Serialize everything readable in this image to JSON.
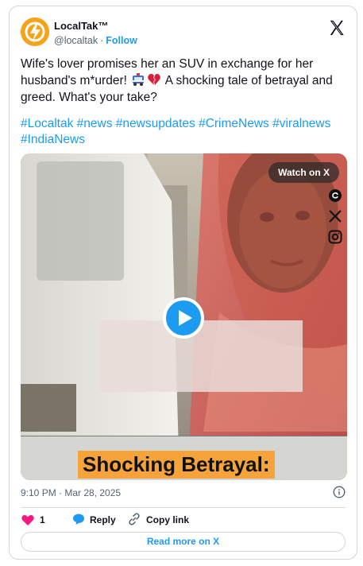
{
  "author": {
    "display_name": "LocalTak™",
    "handle": "@localtak",
    "separator": "·",
    "follow_label": "Follow",
    "avatar_color": "#f6a31a"
  },
  "tweet": {
    "text_before_emoji": "Wife's lover promises her an SUV in exchange for her husband's m*urder! ",
    "emojis": [
      "police-car-icon",
      "broken-heart-icon"
    ],
    "text_after_emoji": " A shocking tale of betrayal and greed. What's your take?",
    "hashtags": [
      "#Localtak",
      "#news",
      "#newsupdates",
      "#CrimeNews",
      "#viralnews",
      "#IndiaNews"
    ]
  },
  "media": {
    "watch_label": "Watch on X",
    "side_icons": [
      "threads-icon",
      "x-logo-icon",
      "instagram-icon"
    ],
    "caption": "Shocking Betrayal:",
    "caption_bg": "#f5a33a",
    "play_color": "#1d9bf0"
  },
  "meta": {
    "timestamp": "9:10 PM · Mar 28, 2025"
  },
  "actions": {
    "like_count": "1",
    "reply_label": "Reply",
    "copy_link_label": "Copy link"
  },
  "read_more_label": "Read more on X",
  "colors": {
    "accent": "#1d9bf0",
    "like": "#f91880",
    "text": "#0f1419",
    "muted": "#536471",
    "border": "#cfd9de"
  }
}
